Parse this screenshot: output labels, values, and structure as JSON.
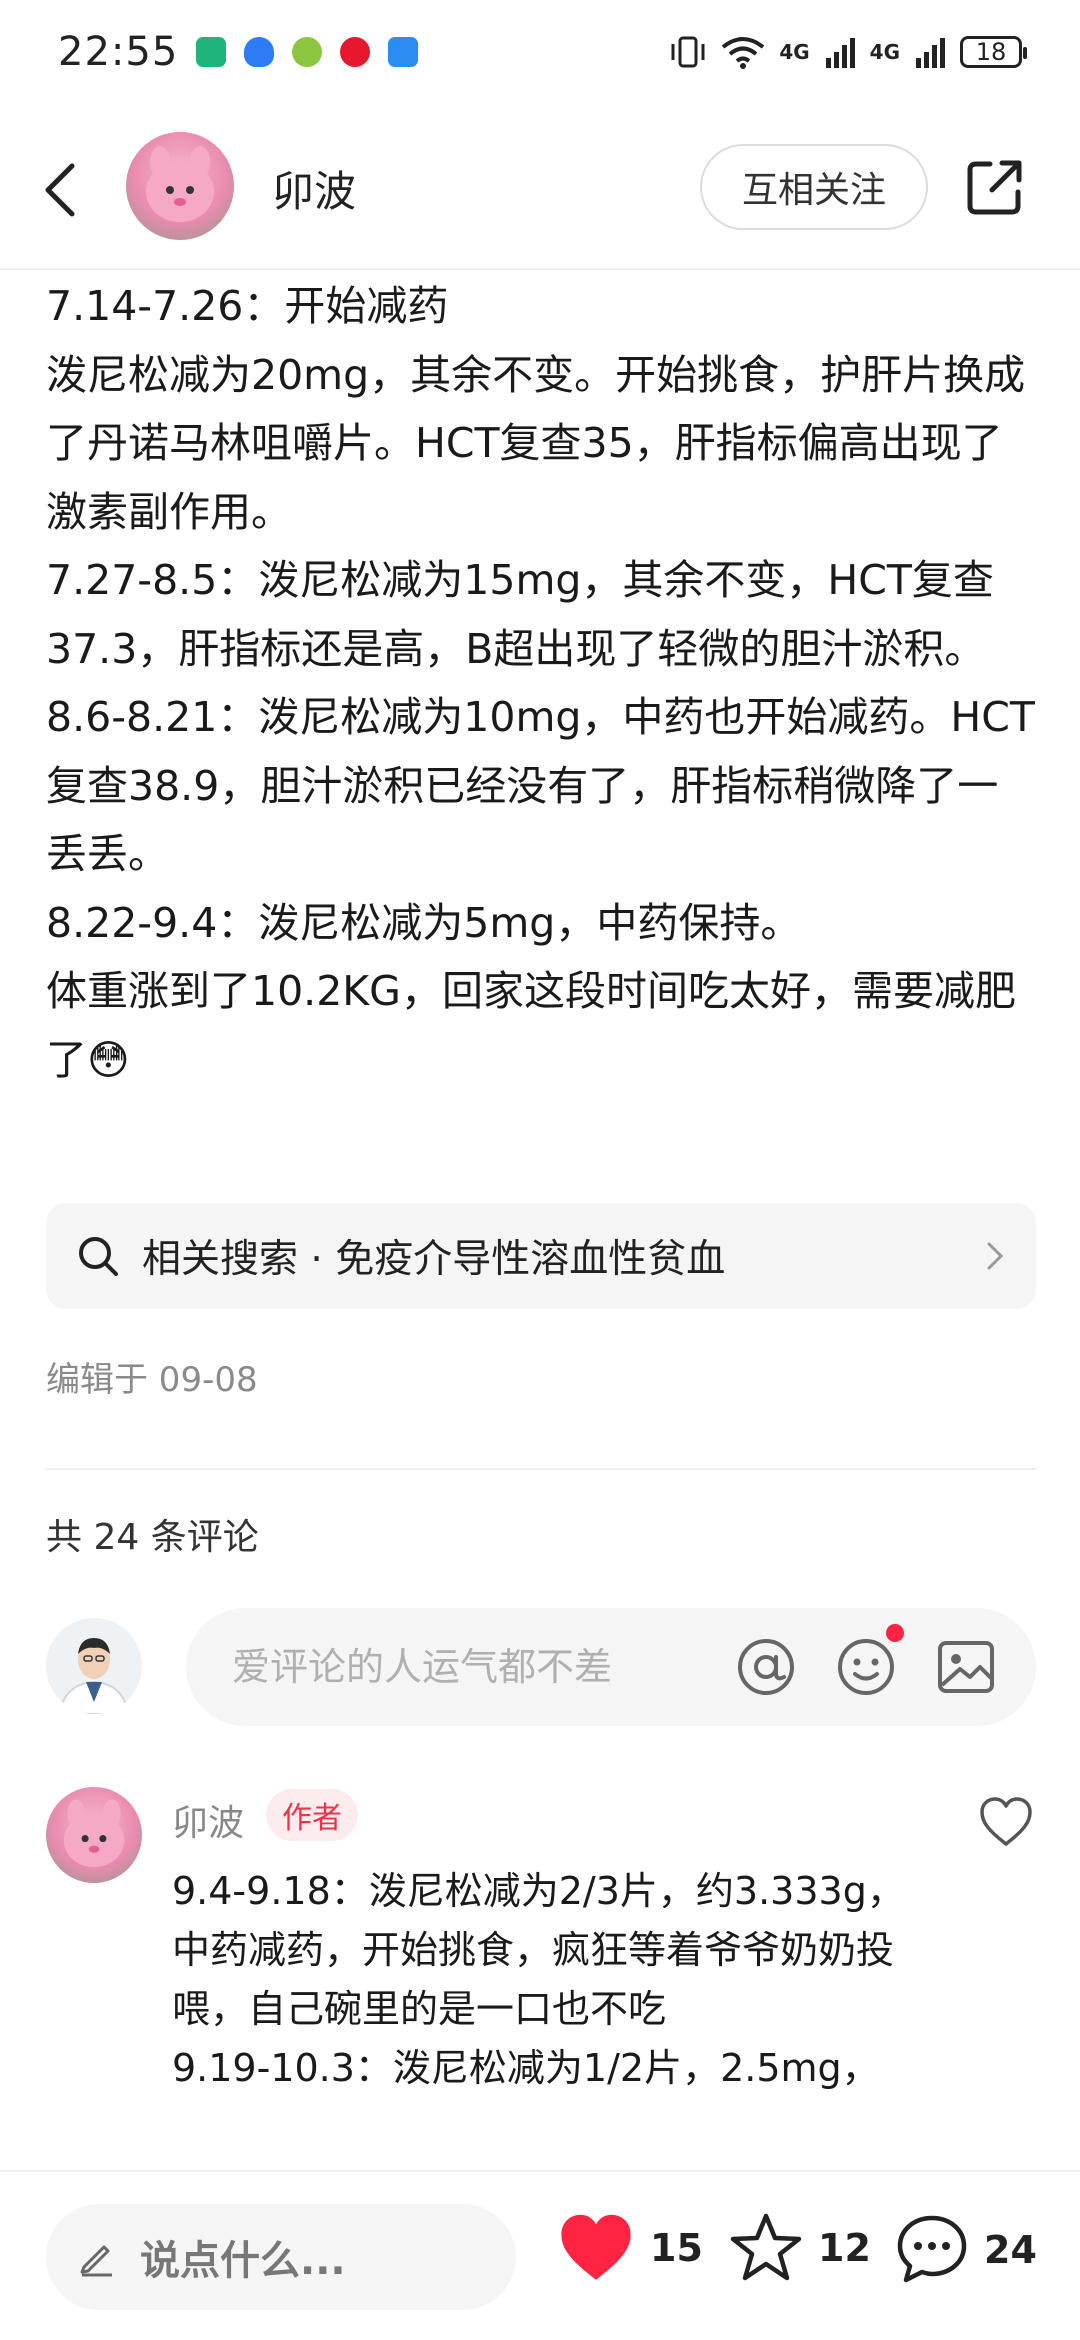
{
  "status_bar": {
    "time": "22:55",
    "network1": "4G",
    "network2": "4G",
    "battery": "18"
  },
  "header": {
    "author_name": "卯波",
    "follow_label": "互相关注"
  },
  "post": {
    "paragraphs": [
      "7.14-7.26：开始减药",
      "泼尼松减为20mg，其余不变。开始挑食，护肝片换成了丹诺马林咀嚼片。HCT复查35，肝指标偏高出现了激素副作用。",
      "7.27-8.5：泼尼松减为15mg，其余不变，HCT复查37.3，肝指标还是高，B超出现了轻微的胆汁淤积。",
      "8.6-8.21：泼尼松减为10mg，中药也开始减药。HCT复查38.9，胆汁淤积已经没有了，肝指标稍微降了一丢丢。",
      "8.22-9.4：泼尼松减为5mg，中药保持。",
      "体重涨到了10.2KG，回家这段时间吃太好，需要减肥了😳"
    ],
    "related_search": "相关搜索 · 免疫介导性溶血性贫血",
    "edited": "编辑于 09-08"
  },
  "comments": {
    "count_label": "共 24 条评论",
    "input_placeholder": "爱评论的人运气都不差",
    "first": {
      "name": "卯波",
      "badge": "作者",
      "lines": [
        "9.4-9.18：泼尼松减为2/3片，约3.333g，中药减药，开始挑食，疯狂等着爷爷奶奶投喂，自己碗里的是一口也不吃",
        "9.19-10.3：泼尼松减为1/2片，2.5mg，"
      ]
    }
  },
  "bottom_bar": {
    "say_placeholder": "说点什么...",
    "likes": "15",
    "favorites": "12",
    "comments": "24"
  },
  "colors": {
    "like_red": "#ff2442",
    "badge_red": "#e8334a",
    "muted": "#8a8a8a"
  },
  "icons": [
    "back-icon",
    "share-icon",
    "search-icon",
    "chevron-right-icon",
    "at-icon",
    "emoji-icon",
    "image-icon",
    "heart-outline-icon",
    "pencil-icon",
    "heart-filled-icon",
    "star-icon",
    "comment-bubble-icon"
  ]
}
